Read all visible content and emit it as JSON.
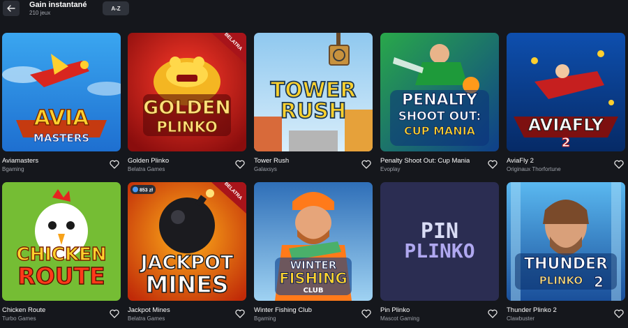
{
  "header": {
    "title": "Gain instantané",
    "subtitle": "210 jeux",
    "sort_label": "A-Z"
  },
  "games": [
    {
      "name": "Aviamasters",
      "provider": "Bgaming",
      "art": [
        "AVIA",
        "MASTERS"
      ],
      "badge": ""
    },
    {
      "name": "Golden Plinko",
      "provider": "Belatra Games",
      "art": [
        "GOLDEN",
        "PLINKO"
      ],
      "badge": "BELATRA"
    },
    {
      "name": "Tower Rush",
      "provider": "Galaxsys",
      "art": [
        "TOWER",
        "RUSH"
      ],
      "badge": ""
    },
    {
      "name": "Penalty Shoot Out: Cup Mania",
      "provider": "Evoplay",
      "art": [
        "PENALTY",
        "SHOOT OUT:",
        "CUP MANIA"
      ],
      "badge": ""
    },
    {
      "name": "AviaFly 2",
      "provider": "Originaux Thorfortune",
      "art": [
        "AVIAFLY",
        "2"
      ],
      "badge": ""
    },
    {
      "name": "Chicken Route",
      "provider": "Turbo Games",
      "art": [
        "CHICKEN",
        "ROUTE"
      ],
      "badge": ""
    },
    {
      "name": "Jackpot Mines",
      "provider": "Belatra Games",
      "art": [
        "JACKPOT",
        "MINES"
      ],
      "badge": "BELATRA",
      "chip": "853 zł"
    },
    {
      "name": "Winter Fishing Club",
      "provider": "Bgaming",
      "art": [
        "WINTER",
        "FISHING",
        "CLUB"
      ],
      "badge": ""
    },
    {
      "name": "Pin Plinko",
      "provider": "Mascot Gaming",
      "art": [
        "PIN",
        "PLINKO"
      ],
      "badge": ""
    },
    {
      "name": "Thunder Plinko 2",
      "provider": "Clawbuster",
      "art": [
        "THUNDER",
        "PLINKO",
        "2"
      ],
      "badge": ""
    }
  ],
  "icons": {
    "back": "arrow-left-icon",
    "favorite": "heart-outline-icon"
  }
}
